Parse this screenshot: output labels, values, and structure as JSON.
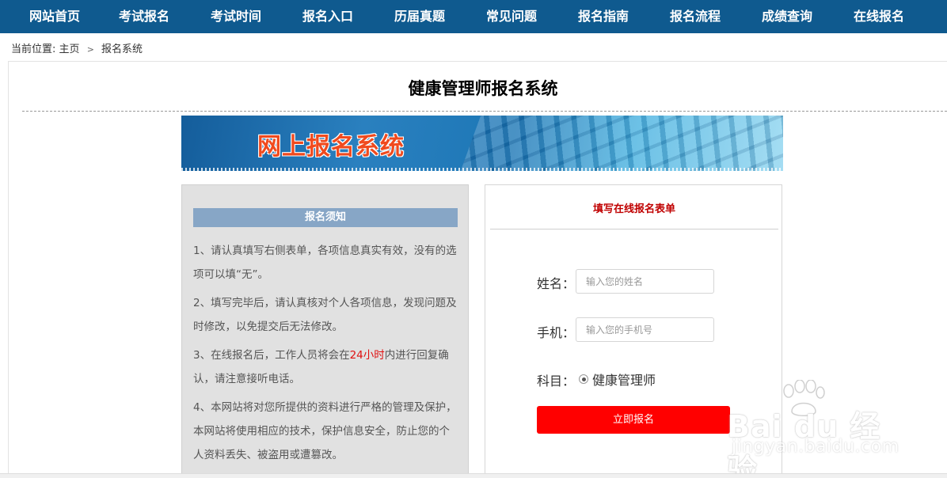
{
  "nav": {
    "items": [
      "网站首页",
      "考试报名",
      "考试时间",
      "报名入口",
      "历届真题",
      "常见问题",
      "报名指南",
      "报名流程",
      "成绩查询",
      "在线报名"
    ]
  },
  "breadcrumb": {
    "prefix": "当前位置:",
    "home": "主页",
    "separator": ">",
    "current": "报名系统"
  },
  "page": {
    "title": "健康管理师报名系统"
  },
  "banner": {
    "text": "网上报名系统"
  },
  "notice": {
    "header": "报名须知",
    "items": [
      {
        "text": "1、请认真填写右侧表单，各项信息真实有效，没有的选项可以填“无”。"
      },
      {
        "text": "2、填写完毕后，请认真核对个人各项信息，发现问题及时修改，以免提交后无法修改。"
      },
      {
        "before": "3、在线报名后，工作人员将会在",
        "highlight": "24小时",
        "after": "内进行回复确认，请注意接听电话。"
      },
      {
        "text": "4、本网站将对您所提供的资料进行严格的管理及保护，本网站将使用相应的技术，保护信息安全，防止您的个人资料丢失、被盗用或遭篡改。"
      }
    ],
    "highlight_color": "#e01010"
  },
  "form": {
    "title": "填写在线报名表单",
    "name_label": "姓名：",
    "name_placeholder": "输入您的姓名",
    "phone_label": "手机：",
    "phone_placeholder": "输入您的手机号",
    "subject_label": "科目：",
    "subject_option": "健康管理师",
    "subject_selected": true,
    "submit_label": "立即报名"
  },
  "watermark": {
    "text": "Bai du 经验",
    "sub": "jingyan.baidu.com"
  },
  "colors": {
    "nav_bg": "#0f5a8f",
    "notice_header_bg": "#87a6c6",
    "form_title": "#c00000",
    "submit_bg": "#ff0000"
  }
}
